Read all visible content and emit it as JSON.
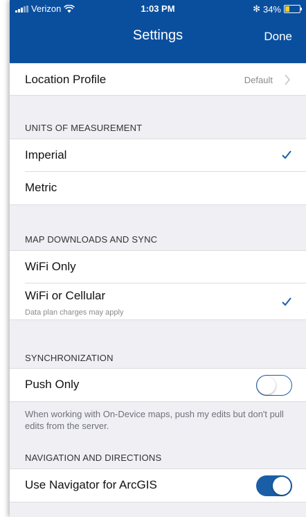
{
  "status": {
    "carrier": "Verizon",
    "time": "1:03 PM",
    "bluetooth": "✻",
    "battery_percent": "34%",
    "battery_level": 0.34
  },
  "nav": {
    "title": "Settings",
    "done_label": "Done"
  },
  "location_profile": {
    "label": "Location Profile",
    "value": "Default"
  },
  "units": {
    "header": "UNITS OF MEASUREMENT",
    "items": [
      {
        "label": "Imperial",
        "checked": true
      },
      {
        "label": "Metric",
        "checked": false
      }
    ]
  },
  "downloads": {
    "header": "MAP DOWNLOADS AND SYNC",
    "items": [
      {
        "label": "WiFi Only",
        "checked": false
      },
      {
        "label": "WiFi or Cellular",
        "sublabel": "Data plan charges may apply",
        "checked": true
      }
    ]
  },
  "sync": {
    "header": "SYNCHRONIZATION",
    "push_only": {
      "label": "Push Only",
      "on": false
    },
    "note": "When working with On-Device maps, push my edits but don't pull edits from the server."
  },
  "navigation": {
    "header": "NAVIGATION AND DIRECTIONS",
    "navigator": {
      "label": "Use Navigator for ArcGIS",
      "on": true
    }
  },
  "colors": {
    "header_bg": "#0a4f9e",
    "accent": "#1a5ea8",
    "group_bg": "#efeff4"
  }
}
